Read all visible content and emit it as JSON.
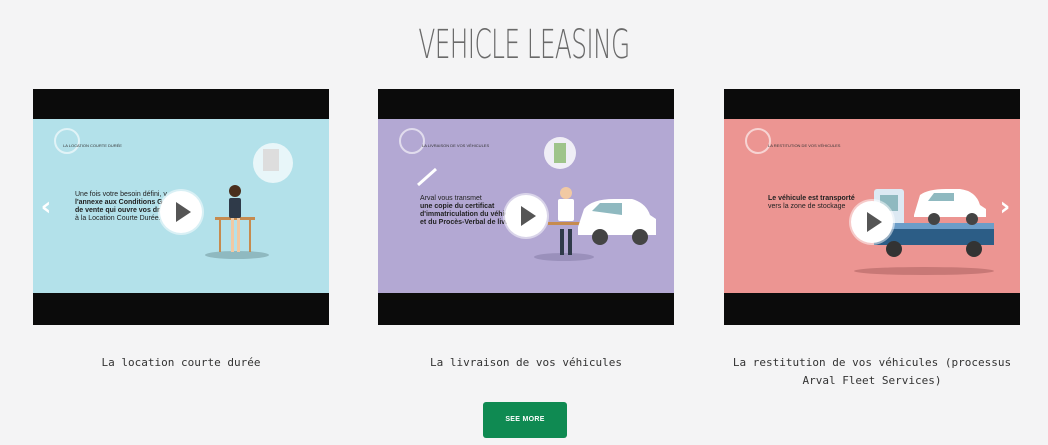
{
  "section": {
    "title": "VEHICLE LEASING"
  },
  "carousel": {
    "prev_label": "‹",
    "next_label": "›",
    "cards": [
      {
        "caption": "La location courte durée",
        "scene_bg": "#b3e1ea",
        "scene_heading": "LA LOCATION COURTE DURÉE",
        "scene_text_1": "Une fois votre besoin défini, v",
        "scene_text_2": "l'annexe aux Conditions G",
        "scene_text_3": "de vente qui ouvre vos dr",
        "scene_text_4": "à la Location Courte Durée."
      },
      {
        "caption": "La livraison de vos véhicules",
        "scene_bg": "#b3a8d3",
        "scene_heading": "LA LIVRAISON DE VOS VÉHICULES",
        "scene_text_1": "Arval vous transmet",
        "scene_text_2": "une copie du certificat",
        "scene_text_3": "d'immatriculation du véhic",
        "scene_text_4": "et du Procès-Verbal de livrai"
      },
      {
        "caption": "La restitution de vos véhicules (processus Arval Fleet Services)",
        "scene_bg": "#ec9592",
        "scene_heading": "LA RESTITUTION DE VOS VÉHICULES",
        "scene_text_1": "Le véhicule est transporté",
        "scene_text_2": "vers la zone de stockage"
      }
    ]
  },
  "actions": {
    "see_more_label": "SEE MORE"
  },
  "colors": {
    "button_green": "#0f8a52",
    "page_bg": "#f4f4f5"
  }
}
